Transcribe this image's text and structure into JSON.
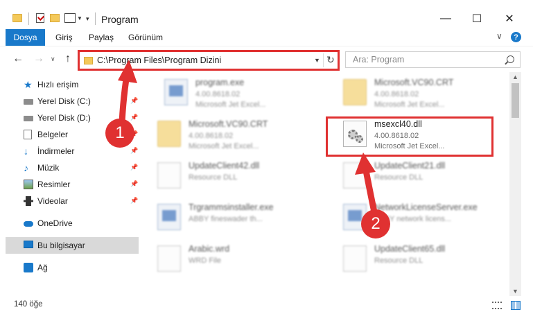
{
  "window": {
    "title": "Program",
    "minimize_icon": "minimize-icon",
    "maximize_icon": "maximize-icon",
    "close_icon": "close-icon"
  },
  "ribbon": {
    "tabs": [
      {
        "label": "Dosya",
        "active": true
      },
      {
        "label": "Giriş"
      },
      {
        "label": "Paylaş"
      },
      {
        "label": "Görünüm"
      }
    ],
    "accent_color": "#1979ca"
  },
  "address": {
    "path": "C:\\Program Files\\Program Dizini",
    "search_placeholder": "Ara: Program"
  },
  "sidebar": {
    "items": [
      {
        "label": "Hızlı erişim",
        "icon": "star-icon"
      },
      {
        "label": "Yerel Disk (C:)",
        "icon": "drive-icon",
        "pinned": true
      },
      {
        "label": "Yerel Disk (D:)",
        "icon": "drive-icon",
        "pinned": true
      },
      {
        "label": "Belgeler",
        "icon": "documents-icon",
        "pinned": true
      },
      {
        "label": "İndirmeler",
        "icon": "download-icon",
        "pinned": true
      },
      {
        "label": "Müzik",
        "icon": "music-icon",
        "pinned": true
      },
      {
        "label": "Resimler",
        "icon": "pictures-icon",
        "pinned": true
      },
      {
        "label": "Videolar",
        "icon": "videos-icon",
        "pinned": true
      },
      {
        "label": "OneDrive",
        "icon": "onedrive-icon"
      },
      {
        "label": "Bu bilgisayar",
        "icon": "computer-icon",
        "selected": true
      },
      {
        "label": "Ağ",
        "icon": "network-icon"
      }
    ]
  },
  "files": [
    {
      "name": "program.exe",
      "line2": "4.00.8618.02",
      "line3": "Microsoft Jet Excel...",
      "icon": "exe-icon"
    },
    {
      "name": "Microsoft.VC90.CRT",
      "line2": "4.00.8618.02",
      "line3": "Microsoft Jet Excel...",
      "icon": "folder-icon"
    },
    {
      "name": "Microsoft.VC90.CRT",
      "line2": "4.00.8618.02",
      "line3": "Microsoft Jet Excel...",
      "icon": "folder-icon"
    },
    {
      "name": "msexcl40.dll",
      "line2": "4.00.8618.02",
      "line3": "Microsoft Jet Excel...",
      "icon": "dll-gear-icon",
      "highlighted": true
    },
    {
      "name": "UpdateClient42.dll",
      "line2": "Resource DLL",
      "line3": "",
      "icon": "dll-icon"
    },
    {
      "name": "UpdateClient21.dll",
      "line2": "Resource DLL",
      "line3": "",
      "icon": "dll-icon"
    },
    {
      "name": "Trgrammsinstaller.exe",
      "line2": "ABBY fineswader th...",
      "line3": "",
      "icon": "exe-icon"
    },
    {
      "name": "NetworkLicenseServer.exe",
      "line2": "ABBY network licens...",
      "line3": "",
      "icon": "exe-icon"
    },
    {
      "name": "Arabic.wrd",
      "line2": "WRD File",
      "line3": "",
      "icon": "document-icon"
    },
    {
      "name": "UpdateClient65.dll",
      "line2": "Resource DLL",
      "line3": "",
      "icon": "dll-icon"
    }
  ],
  "status": {
    "item_count": "140 öğe"
  },
  "annotations": {
    "step1": "1",
    "step2": "2",
    "color": "#e03131"
  }
}
